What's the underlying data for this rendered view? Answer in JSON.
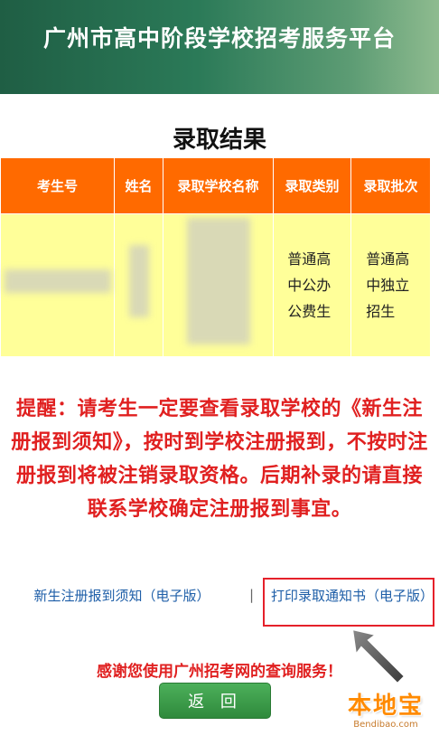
{
  "header": {
    "title": "广州市高中阶段学校招考服务平台"
  },
  "result": {
    "title": "录取结果",
    "columns": [
      "考生号",
      "姓名",
      "录取学校名称",
      "录取类别",
      "录取批次"
    ],
    "row": {
      "category": "普通高中公办公费生",
      "batch": "普通高中独立招生"
    }
  },
  "notice": "提醒：请考生一定要查看录取学校的《新生注册报到须知》，按时到学校注册报到，不按时注册报到将被注销录取资格。后期补录的请直接联系学校确定注册报到事宜。",
  "links": {
    "registration_notice": "新生注册报到须知（电子版）",
    "separator": "|",
    "print_notice": "打印录取通知书（电子版）"
  },
  "thanks": "感谢您使用广州招考网的查询服务！",
  "back_button": "返 回",
  "watermark": {
    "logo_text": "本地宝",
    "url": "Bendibao.com"
  },
  "colors": {
    "header_green": "#2b7a58",
    "table_header": "#ff6a00",
    "table_body": "#ffff99",
    "notice_red": "#e02020",
    "link_blue": "#1f5fa8",
    "button_green": "#3d9b49"
  }
}
